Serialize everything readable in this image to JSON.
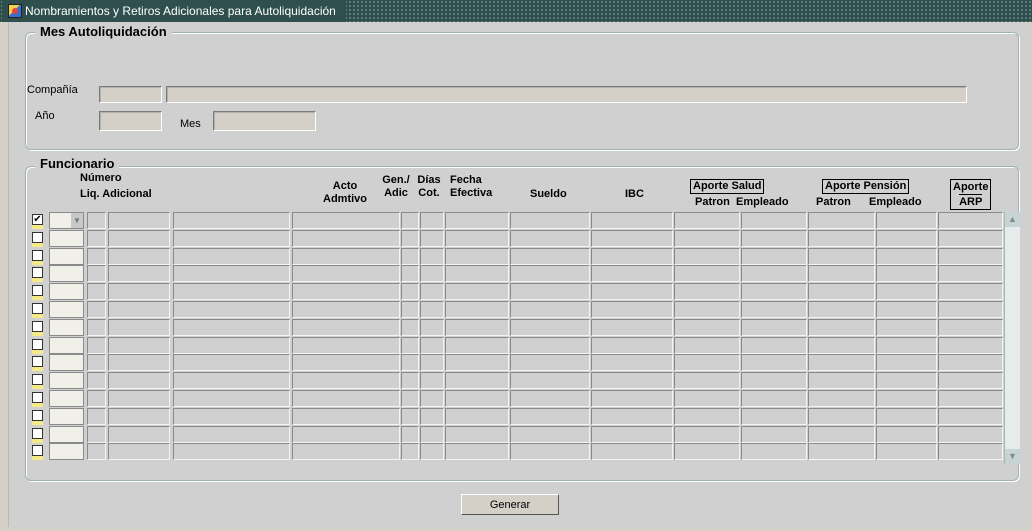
{
  "window": {
    "title": "Nombramientos y Retiros Adicionales  para Autoliquidación"
  },
  "mes": {
    "legend": "Mes Autoliquidación",
    "compania_label": "Compañía",
    "compania_code": "",
    "compania_name": "",
    "anio_label": "Año",
    "anio_value": "",
    "mes_label": "Mes",
    "mes_value": ""
  },
  "funcionario": {
    "legend": "Funcionario",
    "headers": {
      "numero": "Número",
      "liq_adicional": "Liq. Adicional",
      "acto": "Acto",
      "admtivo": "Admtivo",
      "gen": "Gen./",
      "adic": "Adic",
      "dias": "Días",
      "cot": "Cot.",
      "fecha": "Fecha",
      "efectiva": "Efectiva",
      "sueldo": "Sueldo",
      "ibc": "IBC",
      "aporte_salud": "Aporte Salud",
      "patron_salud": "Patron",
      "empleado_salud": "Empleado",
      "aporte_pension": "Aporte Pensión",
      "patron_pension": "Patron",
      "empleado_pension": "Empleado",
      "aporte": "Aporte",
      "arp": "ARP"
    },
    "row_count": 14,
    "first_row_checked": true
  },
  "icons": {
    "app": "oracle-forms-icon",
    "check": "checkmark-icon",
    "combo": "chevron-down-icon",
    "scroll_up": "scroll-up-icon",
    "scroll_down": "scroll-down-icon"
  },
  "buttons": {
    "generar": "Generar"
  }
}
